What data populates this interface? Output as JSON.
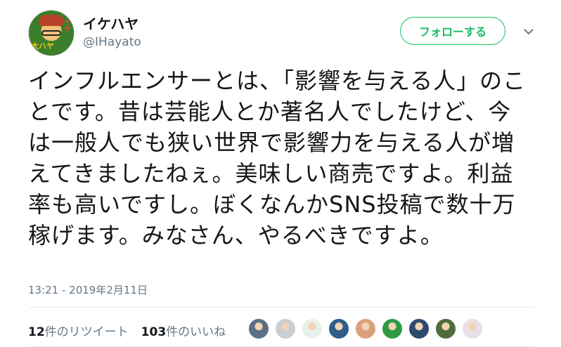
{
  "user": {
    "display_name": "イケハヤ",
    "handle": "@IHayato",
    "avatar_icon": "avatar-illustration-icon"
  },
  "follow_button": {
    "label": "フォローする",
    "color": "#17bf63"
  },
  "menu_icon": "chevron-down-icon",
  "tweet": {
    "text": "インフルエンサーとは、「影響を与える人」のことです。昔は芸能人とか著名人でしたけど、今は一般人でも狭い世界で影響力を与える人が増えてきましたねぇ。美味しい商売ですよ。利益率も高いですし。ぼくなんかSNS投稿で数十万稼げます。みなさん、やるべきですよ。",
    "timestamp": "13:21 - 2019年2月11日"
  },
  "stats": {
    "retweets_count": "12",
    "retweets_label": "件のリツイート",
    "likes_count": "103",
    "likes_label": "件のいいね"
  },
  "likers": [
    {
      "icon": "liker-avatar-1",
      "color": "#5b6f86"
    },
    {
      "icon": "liker-avatar-2",
      "color": "#c9ced3"
    },
    {
      "icon": "liker-avatar-3",
      "color": "#e9f2ea"
    },
    {
      "icon": "liker-avatar-4",
      "color": "#2f5d8c"
    },
    {
      "icon": "liker-avatar-5",
      "color": "#d9a07b"
    },
    {
      "icon": "liker-avatar-6",
      "color": "#2e9a46"
    },
    {
      "icon": "liker-avatar-7",
      "color": "#2b4a6e"
    },
    {
      "icon": "liker-avatar-8",
      "color": "#4f6b3b"
    },
    {
      "icon": "liker-avatar-9",
      "color": "#e9dfe6"
    }
  ]
}
